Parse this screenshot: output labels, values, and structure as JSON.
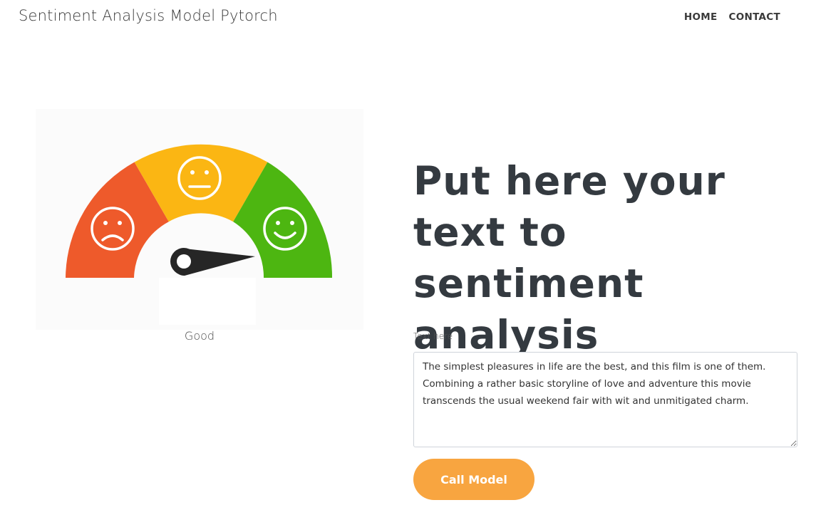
{
  "navbar": {
    "brand": "Sentiment Analysis Model Pytorch",
    "links": [
      "HOME",
      "CONTACT"
    ]
  },
  "gauge": {
    "segments": [
      {
        "icon": "sad-face-icon",
        "color": "#ee5a2b"
      },
      {
        "icon": "neutral-face-icon",
        "color": "#fbb613"
      },
      {
        "icon": "happy-face-icon",
        "color": "#4db611"
      }
    ],
    "result": "Good"
  },
  "main": {
    "heading": "Put here your text to sentiment analysis",
    "field_label": "Text here",
    "text_value": "The simplest pleasures in life are the best, and this film is one of them. Combining a rather basic storyline of love and adventure this movie transcends the usual weekend fair with wit and unmitigated charm.",
    "button_label": "Call Model",
    "button_color": "#f8a540"
  }
}
